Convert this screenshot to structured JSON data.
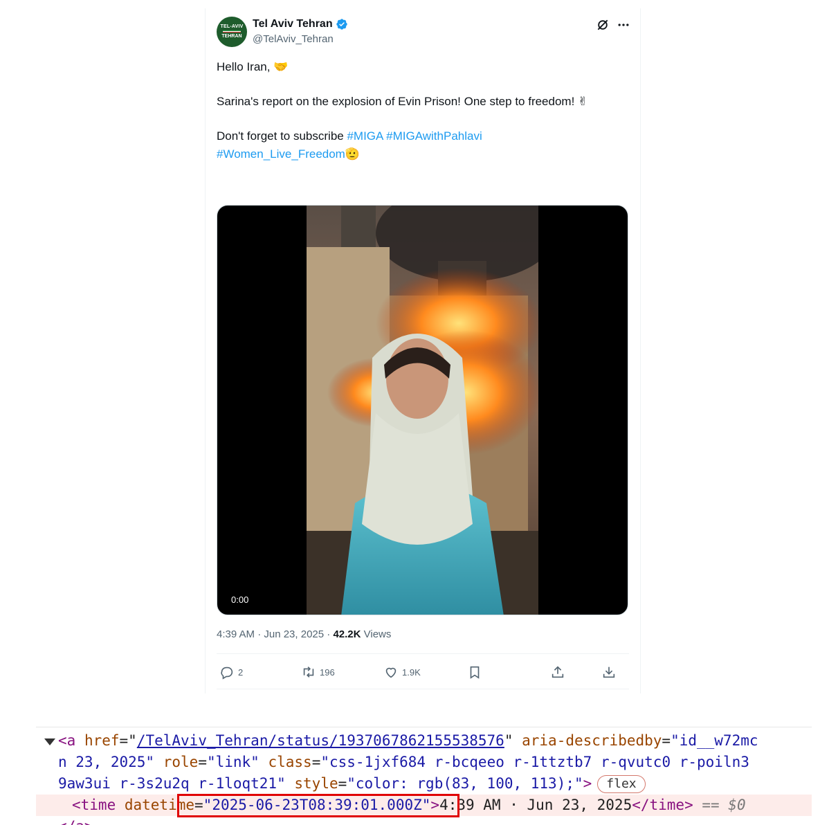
{
  "tweet": {
    "avatar_line1": "TEL-AVIV",
    "avatar_line2": "TEHRAN",
    "display_name": "Tel Aviv Tehran",
    "handle": "@TelAviv_Tehran",
    "line1": "Hello Iran,",
    "line1_emoji": "🤝",
    "line2": "Sarina's report on the explosion of Evin Prison! One step to freedom!",
    "line2_emoji": "✌",
    "line3_prefix": "Don't forget to subscribe ",
    "hashtag1": "#MIGA",
    "hashtag2": "#MIGAwithPahlavi",
    "hashtag3": "#Women_Live_Freedom",
    "line4_emoji": "🫡",
    "video_time": "0:00",
    "timestamp": "4:39 AM · Jun 23, 2025 · ",
    "views_count": "42.2K",
    "views_label": " Views",
    "replies": "2",
    "reposts": "196",
    "likes": "1.9K",
    "colors": {
      "link": "#1d9bf0",
      "verified": "#1d9bf0",
      "muted": "#536471",
      "avatar_bg": "#1e5c2c"
    },
    "icons": [
      "verified-badge-icon",
      "grok-icon",
      "more-icon",
      "reply-icon",
      "repost-icon",
      "like-icon",
      "bookmark-icon",
      "share-icon",
      "download-icon"
    ]
  },
  "devtools": {
    "l1_open": "<a ",
    "l1_attr1": "href",
    "l1_val1": "/TelAviv_Tehran/status/1937067862155538576",
    "l1_attr2": "aria-describedby",
    "l1_val2": "\"id__w72mc",
    "l2_val": "n 23, 2025\"",
    "l2_attr1": "role",
    "l2_val1": "\"link\"",
    "l2_attr2": "class",
    "l2_val2": "\"css-1jxf684 r-bcqeeo r-1ttztb7 r-qvutc0 r-poiln3",
    "l3_val": "9aw3ui r-3s2u2q r-1loqt21\"",
    "l3_attr": "style",
    "l3_style": "\"color: rgb(83, 100, 113);\"",
    "l3_close": ">",
    "l3_pill": "flex",
    "l4_open": "<time ",
    "l4_attr": "datetime",
    "l4_val": "\"2025-06-23T08:39:01.000Z\"",
    "l4_text": "4:39 AM · Jun 23, 2025",
    "l4_close": "</time>",
    "l4_eq": " == $0"
  }
}
